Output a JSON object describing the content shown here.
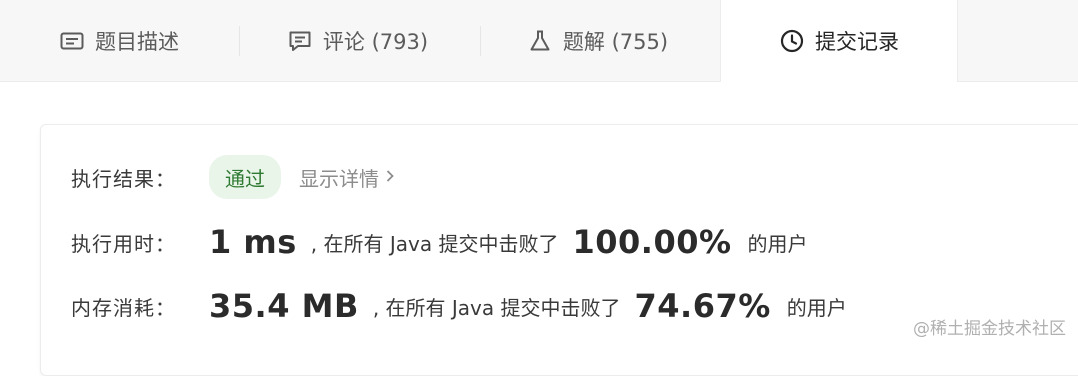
{
  "tabs": [
    {
      "label": "题目描述",
      "icon": "description-icon"
    },
    {
      "label": "评论 (793)",
      "icon": "comment-icon"
    },
    {
      "label": "题解 (755)",
      "icon": "flask-icon"
    },
    {
      "label": "提交记录",
      "icon": "clock-icon",
      "active": true
    }
  ],
  "result": {
    "status_label": "执行结果：",
    "status_value": "通过",
    "detail_link": "显示详情",
    "runtime_label": "执行用时：",
    "runtime_value": "1 ms",
    "runtime_prefix": ", 在所有 Java 提交中击败了",
    "runtime_percent": "100.00%",
    "runtime_suffix": "的用户",
    "memory_label": "内存消耗：",
    "memory_value": "35.4 MB",
    "memory_prefix": ", 在所有 Java 提交中击败了",
    "memory_percent": "74.67%",
    "memory_suffix": "的用户"
  },
  "watermark": "@稀土掘金技术社区",
  "colors": {
    "pass_bg": "#eaf5ea",
    "pass_text": "#2f7a32",
    "tabbar_bg": "#f7f7f7"
  }
}
